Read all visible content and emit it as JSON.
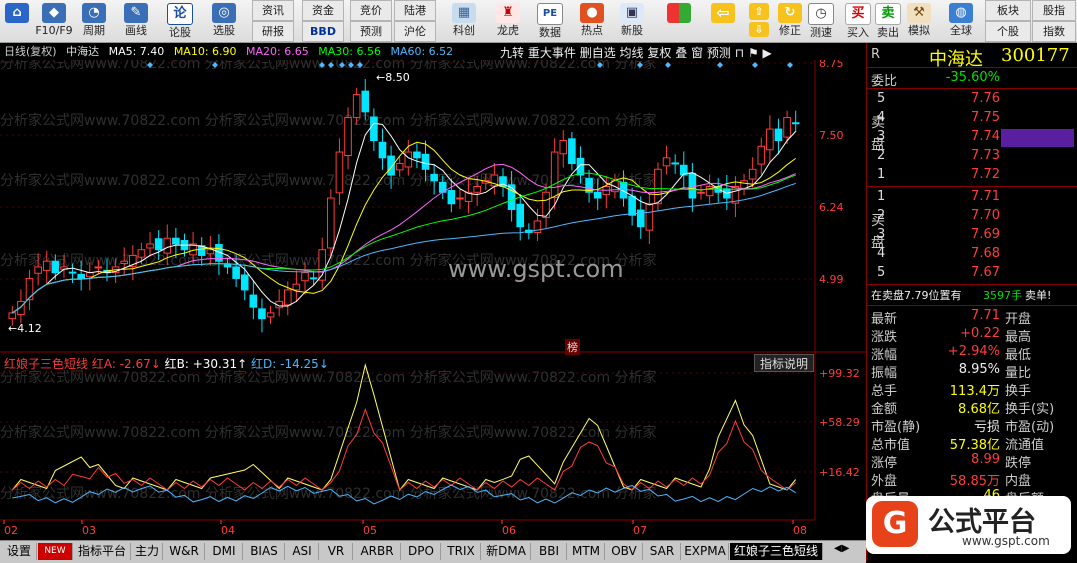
{
  "toolbar": {
    "items": [
      {
        "label": "F10/F9",
        "icon": "◆"
      },
      {
        "label": "周期",
        "icon": "◔"
      },
      {
        "label": "画线",
        "icon": "✎"
      },
      {
        "label": "论股",
        "icon": "论"
      },
      {
        "label": "选股",
        "icon": "◎"
      }
    ],
    "grid_buttons": [
      [
        "资讯",
        "资金",
        "竞价",
        "陆港"
      ],
      [
        "研报",
        "BBD",
        "预测",
        "沪伦"
      ]
    ],
    "items2": [
      {
        "label": "科创",
        "icon": "▦"
      },
      {
        "label": "龙虎",
        "icon": "♜"
      },
      {
        "label": "数据",
        "icon": "PE"
      },
      {
        "label": "热点",
        "icon": "●"
      },
      {
        "label": "新股",
        "icon": "▣"
      }
    ],
    "nav_buttons": [
      {
        "label": "",
        "icon": "▦"
      },
      {
        "label": "",
        "icon": "⇦"
      },
      {
        "label": "修正",
        "icon": "↻"
      },
      {
        "label": "测速",
        "icon": "◷"
      }
    ],
    "trade_buttons": [
      {
        "label": "买入",
        "icon": "买"
      },
      {
        "label": "卖出",
        "icon": "卖"
      },
      {
        "label": "模拟",
        "icon": "⚒"
      },
      {
        "label": "全球",
        "icon": "◍"
      }
    ],
    "right_grid": [
      [
        "板块",
        "股指"
      ],
      [
        "个股",
        "指数"
      ]
    ]
  },
  "main_chart": {
    "header": {
      "period": "日线(复权)",
      "stock": "中海达",
      "ma5": "MA5: 7.40",
      "ma10": "MA10: 6.90",
      "ma20": "MA20: 6.65",
      "ma30": "MA30: 6.56",
      "ma60": "MA60: 6.52"
    },
    "menu": [
      "九转",
      "重大事件",
      "删自选",
      "均线",
      "复权",
      "叠",
      "窗",
      "预测"
    ],
    "price_ticks": [
      "8.75",
      "7.50",
      "6.24",
      "4.99"
    ],
    "high_marker": "8.50",
    "low_marker": "4.12",
    "watermark": "www.gspt.com",
    "repeat_watermark": "分析家公式网www.70822.com 分析家公式网www.70822.com 分析家公式网www.70822.com 分析家",
    "center_label": "榜"
  },
  "indicator": {
    "name": "红娘子三色短线",
    "a": "红A: -2.67",
    "b": "红B: +30.31",
    "d": "红D: -14.25",
    "help": "指标说明",
    "ticks": [
      "99.32",
      "58.29",
      "16.42"
    ]
  },
  "x_axis": [
    "02",
    "03",
    "04",
    "05",
    "06",
    "07",
    "08"
  ],
  "tabs": [
    "设置",
    "NEW",
    "指标平台",
    "主力",
    "W&R",
    "DMI",
    "BIAS",
    "ASI",
    "VR",
    "ARBR",
    "DPO",
    "TRIX",
    "新DMA",
    "BBI",
    "MTM",
    "OBV",
    "SAR",
    "EXPMA",
    "红娘子三色短线"
  ],
  "quote": {
    "code_flag": "R",
    "name": "中海达",
    "code": "300177",
    "weibi_label": "委比",
    "weibi": "-35.60%",
    "sell_label": "卖盘",
    "buy_label": "买盘",
    "sell": [
      {
        "n": "5",
        "p": "7.76"
      },
      {
        "n": "4",
        "p": "7.75"
      },
      {
        "n": "3",
        "p": "7.74"
      },
      {
        "n": "2",
        "p": "7.73"
      },
      {
        "n": "1",
        "p": "7.72"
      }
    ],
    "buy": [
      {
        "n": "1",
        "p": "7.71"
      },
      {
        "n": "2",
        "p": "7.70"
      },
      {
        "n": "3",
        "p": "7.69"
      },
      {
        "n": "4",
        "p": "7.68"
      },
      {
        "n": "5",
        "p": "7.67"
      }
    ],
    "notice": "在卖盘7.79位置有",
    "notice_qty": "3597手",
    "notice_tail": "卖单!",
    "stats": [
      {
        "l": "最新",
        "v": "7.71",
        "r": "开盘",
        "c": "red"
      },
      {
        "l": "涨跌",
        "v": "+0.22",
        "r": "最高",
        "c": "red"
      },
      {
        "l": "涨幅",
        "v": "+2.94%",
        "r": "最低",
        "c": "red"
      },
      {
        "l": "振幅",
        "v": "8.95%",
        "r": "量比",
        "c": "wht"
      },
      {
        "l": "总手",
        "v": "113.4万",
        "r": "换手",
        "c": "yel"
      },
      {
        "l": "金额",
        "v": "8.68亿",
        "r": "换手(实)",
        "c": "yel"
      },
      {
        "l": "市盈(静)",
        "v": "亏损",
        "r": "市盈(动)",
        "c": "wht"
      },
      {
        "l": "总市值",
        "v": "57.38亿",
        "r": "流通值",
        "c": "yel"
      },
      {
        "l": "涨停",
        "v": "8.99",
        "r": "跌停",
        "c": "red"
      },
      {
        "l": "外盘",
        "v": "58.85万",
        "r": "内盘",
        "c": "red"
      },
      {
        "l": "盘后量",
        "v": "46",
        "r": "盘后额",
        "c": "yel"
      }
    ]
  },
  "logo": {
    "title": "公式平台",
    "url": "www.gspt.com"
  },
  "colors": {
    "up": "#ff3c3c",
    "down": "#00e5ff",
    "ma5": "#ffffff",
    "ma10": "#ffff00",
    "ma20": "#ff66ff",
    "ma30": "#00ff00",
    "ma60": "#4db8ff"
  }
}
